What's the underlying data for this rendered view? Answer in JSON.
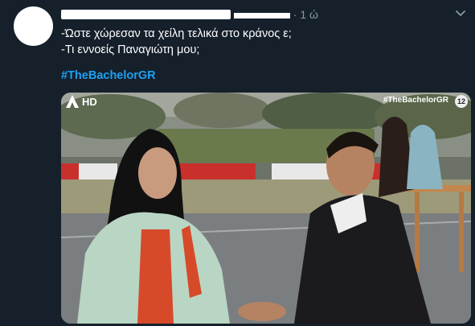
{
  "tweet": {
    "time": "1 ώ",
    "separator": "·",
    "lines": [
      "-Ώστε χώρεσαν τα χείλη τελικά στο κράνος ε;",
      "-Τι εννοείς Παναγιώτη μου;"
    ],
    "hashtag": "#TheBachelorGR"
  },
  "media": {
    "channel_logo": "HD",
    "hashtag_overlay": "#TheBachelorGR",
    "rating_badge": "12"
  },
  "icons": {
    "caret": "chevron-down-icon"
  },
  "colors": {
    "background": "#15202b",
    "hashtag": "#1da1f2",
    "muted": "#8899a6"
  }
}
